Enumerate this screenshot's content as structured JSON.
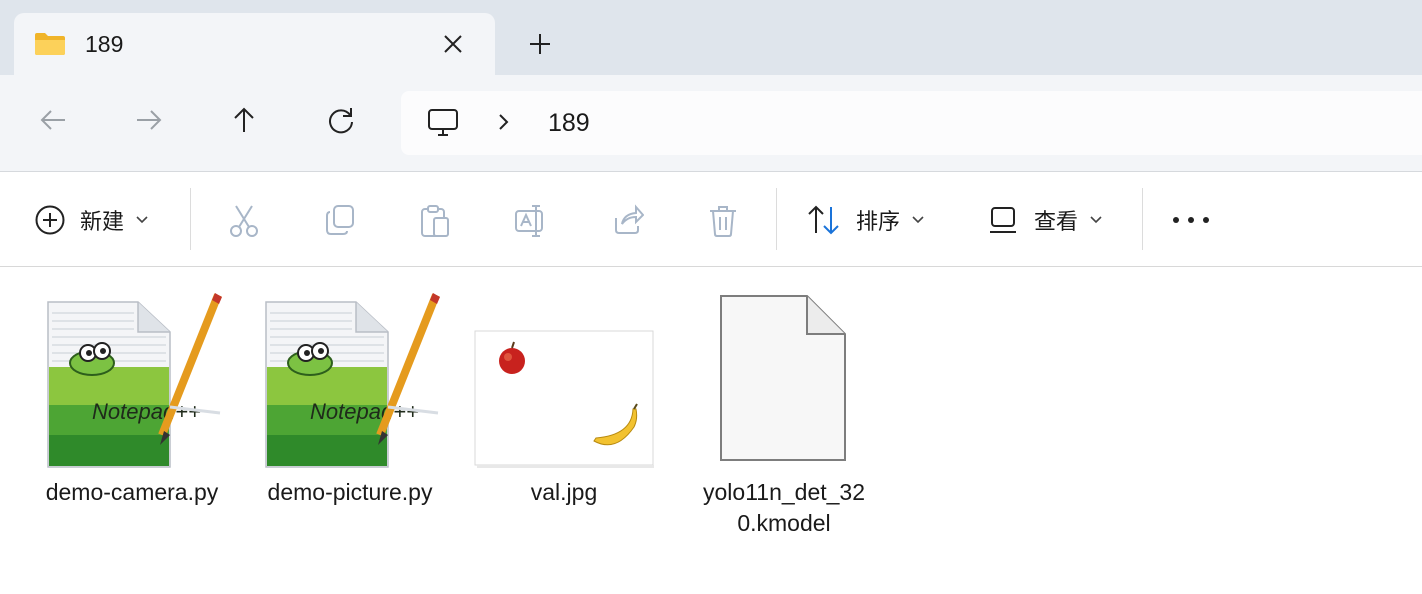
{
  "window": {
    "tab_title": "189",
    "tab_icon": "folder-icon",
    "new_tab_symbol": "+"
  },
  "nav": {
    "back_icon": "arrow-left-icon",
    "forward_icon": "arrow-right-icon",
    "up_icon": "arrow-up-icon",
    "refresh_icon": "refresh-icon",
    "address_root_icon": "computer-icon",
    "path": [
      "189"
    ]
  },
  "toolbar": {
    "new_label": "新建",
    "sort_label": "排序",
    "view_label": "查看",
    "more_symbol": "•••",
    "disabled_icons": [
      "cut-icon",
      "copy-icon",
      "paste-icon",
      "rename-icon",
      "share-icon",
      "delete-icon"
    ]
  },
  "files": [
    {
      "name": "demo-camera.py",
      "icon": "notepad-plus-plus-icon"
    },
    {
      "name": "demo-picture.py",
      "icon": "notepad-plus-plus-icon"
    },
    {
      "name": "val.jpg",
      "icon": "image-thumbnail-apple-banana"
    },
    {
      "name": "yolo11n_det_320.kmodel",
      "icon": "generic-file-icon"
    }
  ],
  "colors": {
    "titlebar": "#dfe5ec",
    "tab": "#f3f5f8",
    "accent": "#1a73d9"
  }
}
